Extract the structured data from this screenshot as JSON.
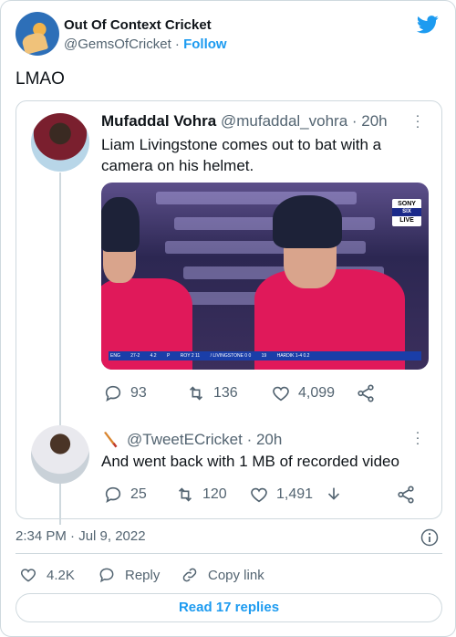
{
  "header": {
    "name": "Out Of Context Cricket",
    "handle": "@GemsOfCricket",
    "separator": " · ",
    "follow": "Follow"
  },
  "tweet_text": "LMAO",
  "quote1": {
    "name": "Mufaddal Vohra",
    "handle_time": "@mufaddal_vohra · 20h",
    "text": "Liam Livingstone comes out to bat with a camera on his helmet.",
    "media": {
      "sony_label": "SONY",
      "six_label": "SIX",
      "live_label": "LIVE",
      "scorebar": [
        "ENG",
        "27-2",
        "4.2",
        "P",
        "ROY 2 11",
        "/ LIVINGSTONE 0 0",
        "19",
        "HARDIK 1-4 0.2"
      ]
    },
    "reply_count": "93",
    "retweet_count": "136",
    "like_count": "4,099"
  },
  "quote2": {
    "handle_time": "@TweetECricket · 20h",
    "text": "And went back with 1 MB of recorded video",
    "reply_count": "25",
    "retweet_count": "120",
    "like_count": "1,491"
  },
  "timestamp": "2:34 PM · Jul 9, 2022",
  "footer": {
    "likes": "4.2K",
    "reply": "Reply",
    "copy_link": "Copy link"
  },
  "read_replies": "Read 17 replies",
  "colors": {
    "accent": "#1d9bf0",
    "text": "#0f1419",
    "muted": "#536471",
    "border": "#cfd9de"
  },
  "icons": [
    "twitter-bird-icon",
    "reply-icon",
    "retweet-icon",
    "like-icon",
    "share-icon",
    "more-icon",
    "info-icon",
    "link-icon",
    "cricket-bat-icon",
    "download-icon"
  ]
}
